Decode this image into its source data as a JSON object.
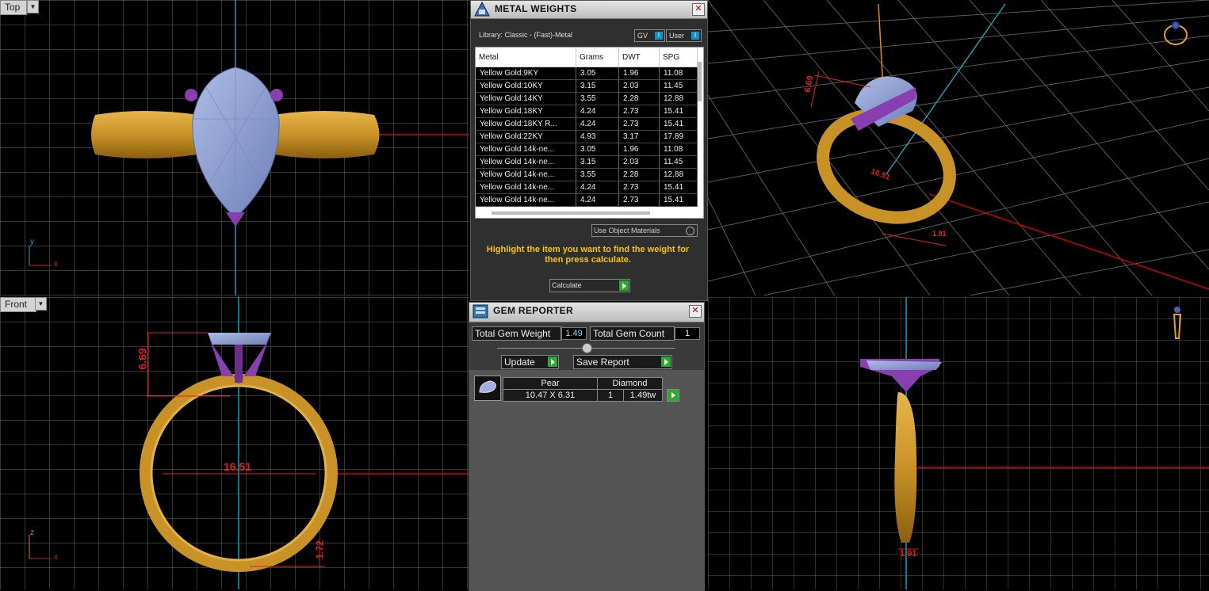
{
  "viewports": {
    "top": {
      "label": "Top",
      "axis_y": "y",
      "axis_x": "x"
    },
    "front": {
      "label": "Front",
      "axis_z": "z",
      "axis_x": "x",
      "dim_height": "6.69",
      "dim_inner": "16.51",
      "dim_band": "1.72"
    },
    "perspective": {
      "dim_a": "6.69",
      "dim_b": "16.51",
      "dim_c": "1.91"
    },
    "side": {
      "dim_width": "1.91"
    }
  },
  "metal_weights": {
    "title": "METAL WEIGHTS",
    "library": "Library: Classic - (Fast)-Metal",
    "gv_label": "GV",
    "user_label": "User",
    "toggle_mark": "I",
    "columns": [
      "Metal",
      "Grams",
      "DWT",
      "SPG"
    ],
    "rows": [
      [
        "Yellow Gold:9KY",
        "3.05",
        "1.96",
        "11.08"
      ],
      [
        "Yellow Gold:10KY",
        "3.15",
        "2.03",
        "11.45"
      ],
      [
        "Yellow Gold:14KY",
        "3.55",
        "2.28",
        "12.88"
      ],
      [
        "Yellow Gold:18KY",
        "4.24",
        "2.73",
        "15.41"
      ],
      [
        "Yellow Gold:18KY R...",
        "4.24",
        "2.73",
        "15.41"
      ],
      [
        "Yellow Gold:22KY",
        "4.93",
        "3.17",
        "17.89"
      ],
      [
        "Yellow Gold 14k-ne...",
        "3.05",
        "1.96",
        "11.08"
      ],
      [
        "Yellow Gold 14k-ne...",
        "3.15",
        "2.03",
        "11.45"
      ],
      [
        "Yellow Gold 14k-ne...",
        "3.55",
        "2.28",
        "12.88"
      ],
      [
        "Yellow Gold 14k-ne...",
        "4.24",
        "2.73",
        "15.41"
      ],
      [
        "Yellow Gold 14k-ne...",
        "4.24",
        "2.73",
        "15.41"
      ]
    ],
    "use_object_materials": "Use Object Materials",
    "hint": "Highlight the item you want to find the weight for then press calculate.",
    "calculate_label": "Calculate"
  },
  "gem_reporter": {
    "title": "GEM REPORTER",
    "total_weight_label": "Total Gem Weight",
    "total_weight_value": "1.49",
    "total_count_label": "Total Gem Count",
    "total_count_value": "1",
    "update_label": "Update",
    "save_report_label": "Save Report",
    "gem": {
      "shape": "Pear",
      "type": "Diamond",
      "size": "10.47 X 6.31",
      "count": "1",
      "weight": "1.49tw"
    }
  },
  "colors": {
    "gold": "#c99a2e",
    "gem": "#8ea3d6",
    "prong": "#8a3fb0",
    "dimension": "#e02020",
    "hint": "#f5c518"
  }
}
